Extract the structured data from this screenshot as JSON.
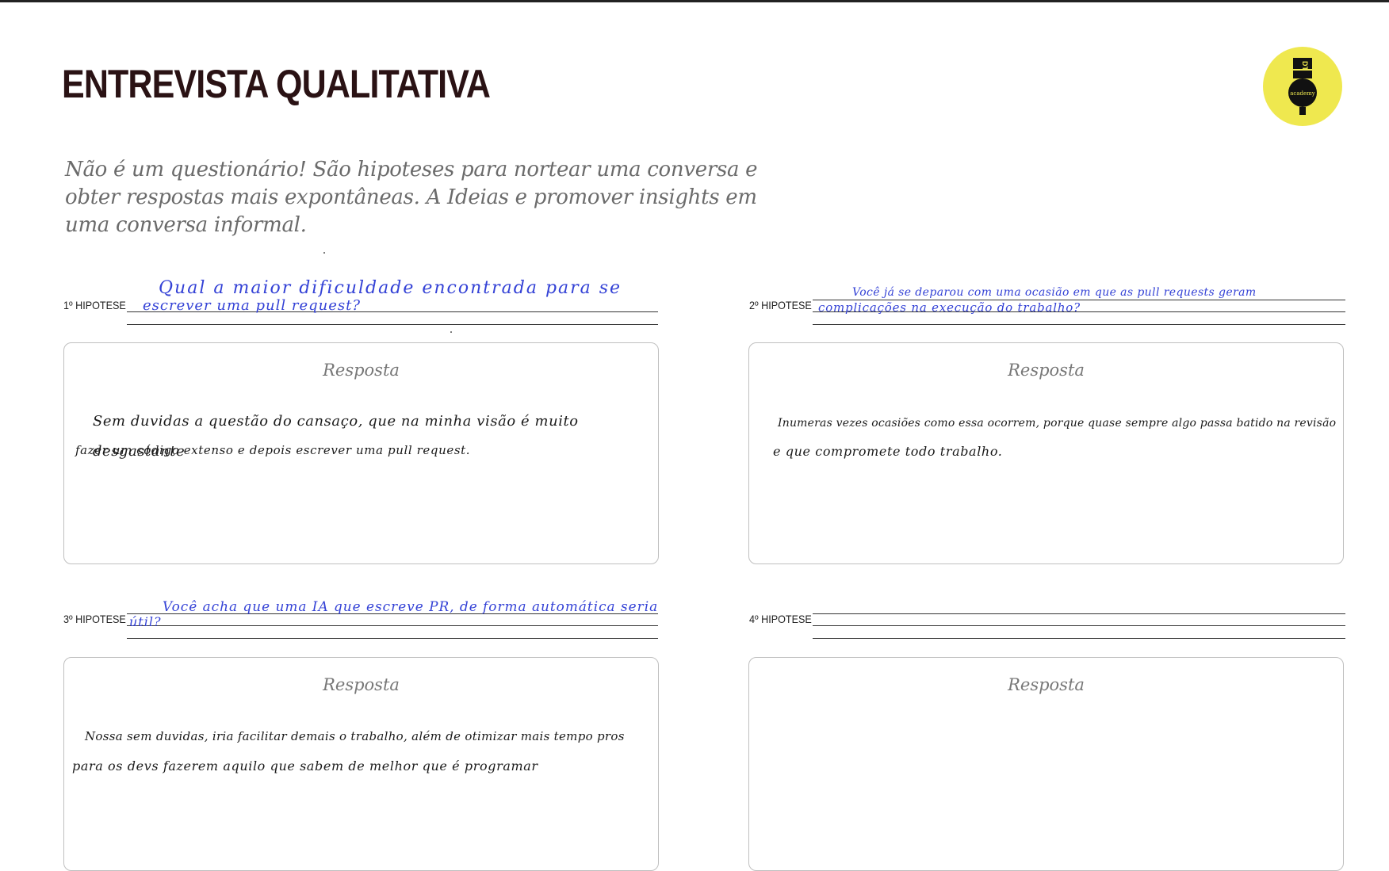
{
  "title": "ENTREVISTA QUALITATIVA",
  "logo": {
    "text_main": "DT",
    "text_sub": "academy",
    "color": "#efe84f"
  },
  "intro": "Não é um questionário! São hipoteses para nortear uma conversa e obter respostas mais expontâneas. A Ideias e promover insights em uma conversa informal.",
  "hypotheses": [
    {
      "label": "1º HIPOTESE",
      "question_line1": "Qual a maior dificuldade encontrada para se",
      "question_line2": "escrever uma pull request?",
      "answer_title": "Resposta",
      "answer_line1": "Sem duvidas a questão do cansaço, que na minha visão é muito desgastante",
      "answer_line2": "fazer um código extenso e depois escrever uma pull request."
    },
    {
      "label": "2º HIPOTESE",
      "question_line1": "Você já se deparou com uma ocasião em que as pull requests geram",
      "question_line2": "complicações na execução do trabalho?",
      "answer_title": "Resposta",
      "answer_line1": "Inumeras vezes ocasiões como essa ocorrem, porque quase sempre algo passa batido na revisão",
      "answer_line2": "e que compromete todo trabalho."
    },
    {
      "label": "3º HIPOTESE",
      "question_line1": "Você acha que uma IA que escreve PR, de forma automática seria",
      "question_line2": "útil?",
      "answer_title": "Resposta",
      "answer_line1": "Nossa sem duvidas, iria facilitar demais o trabalho, além de otimizar mais tempo pros",
      "answer_line2": "para os devs fazerem aquilo que sabem de melhor que é programar"
    },
    {
      "label": "4º HIPOTESE",
      "question_line1": "",
      "question_line2": "",
      "answer_title": "Resposta",
      "answer_line1": "",
      "answer_line2": ""
    }
  ],
  "colors": {
    "title": "#2a1214",
    "handwriting_question": "#3442d6",
    "handwriting_answer": "#1a1a1a",
    "intro_text": "#6b6b6b"
  }
}
